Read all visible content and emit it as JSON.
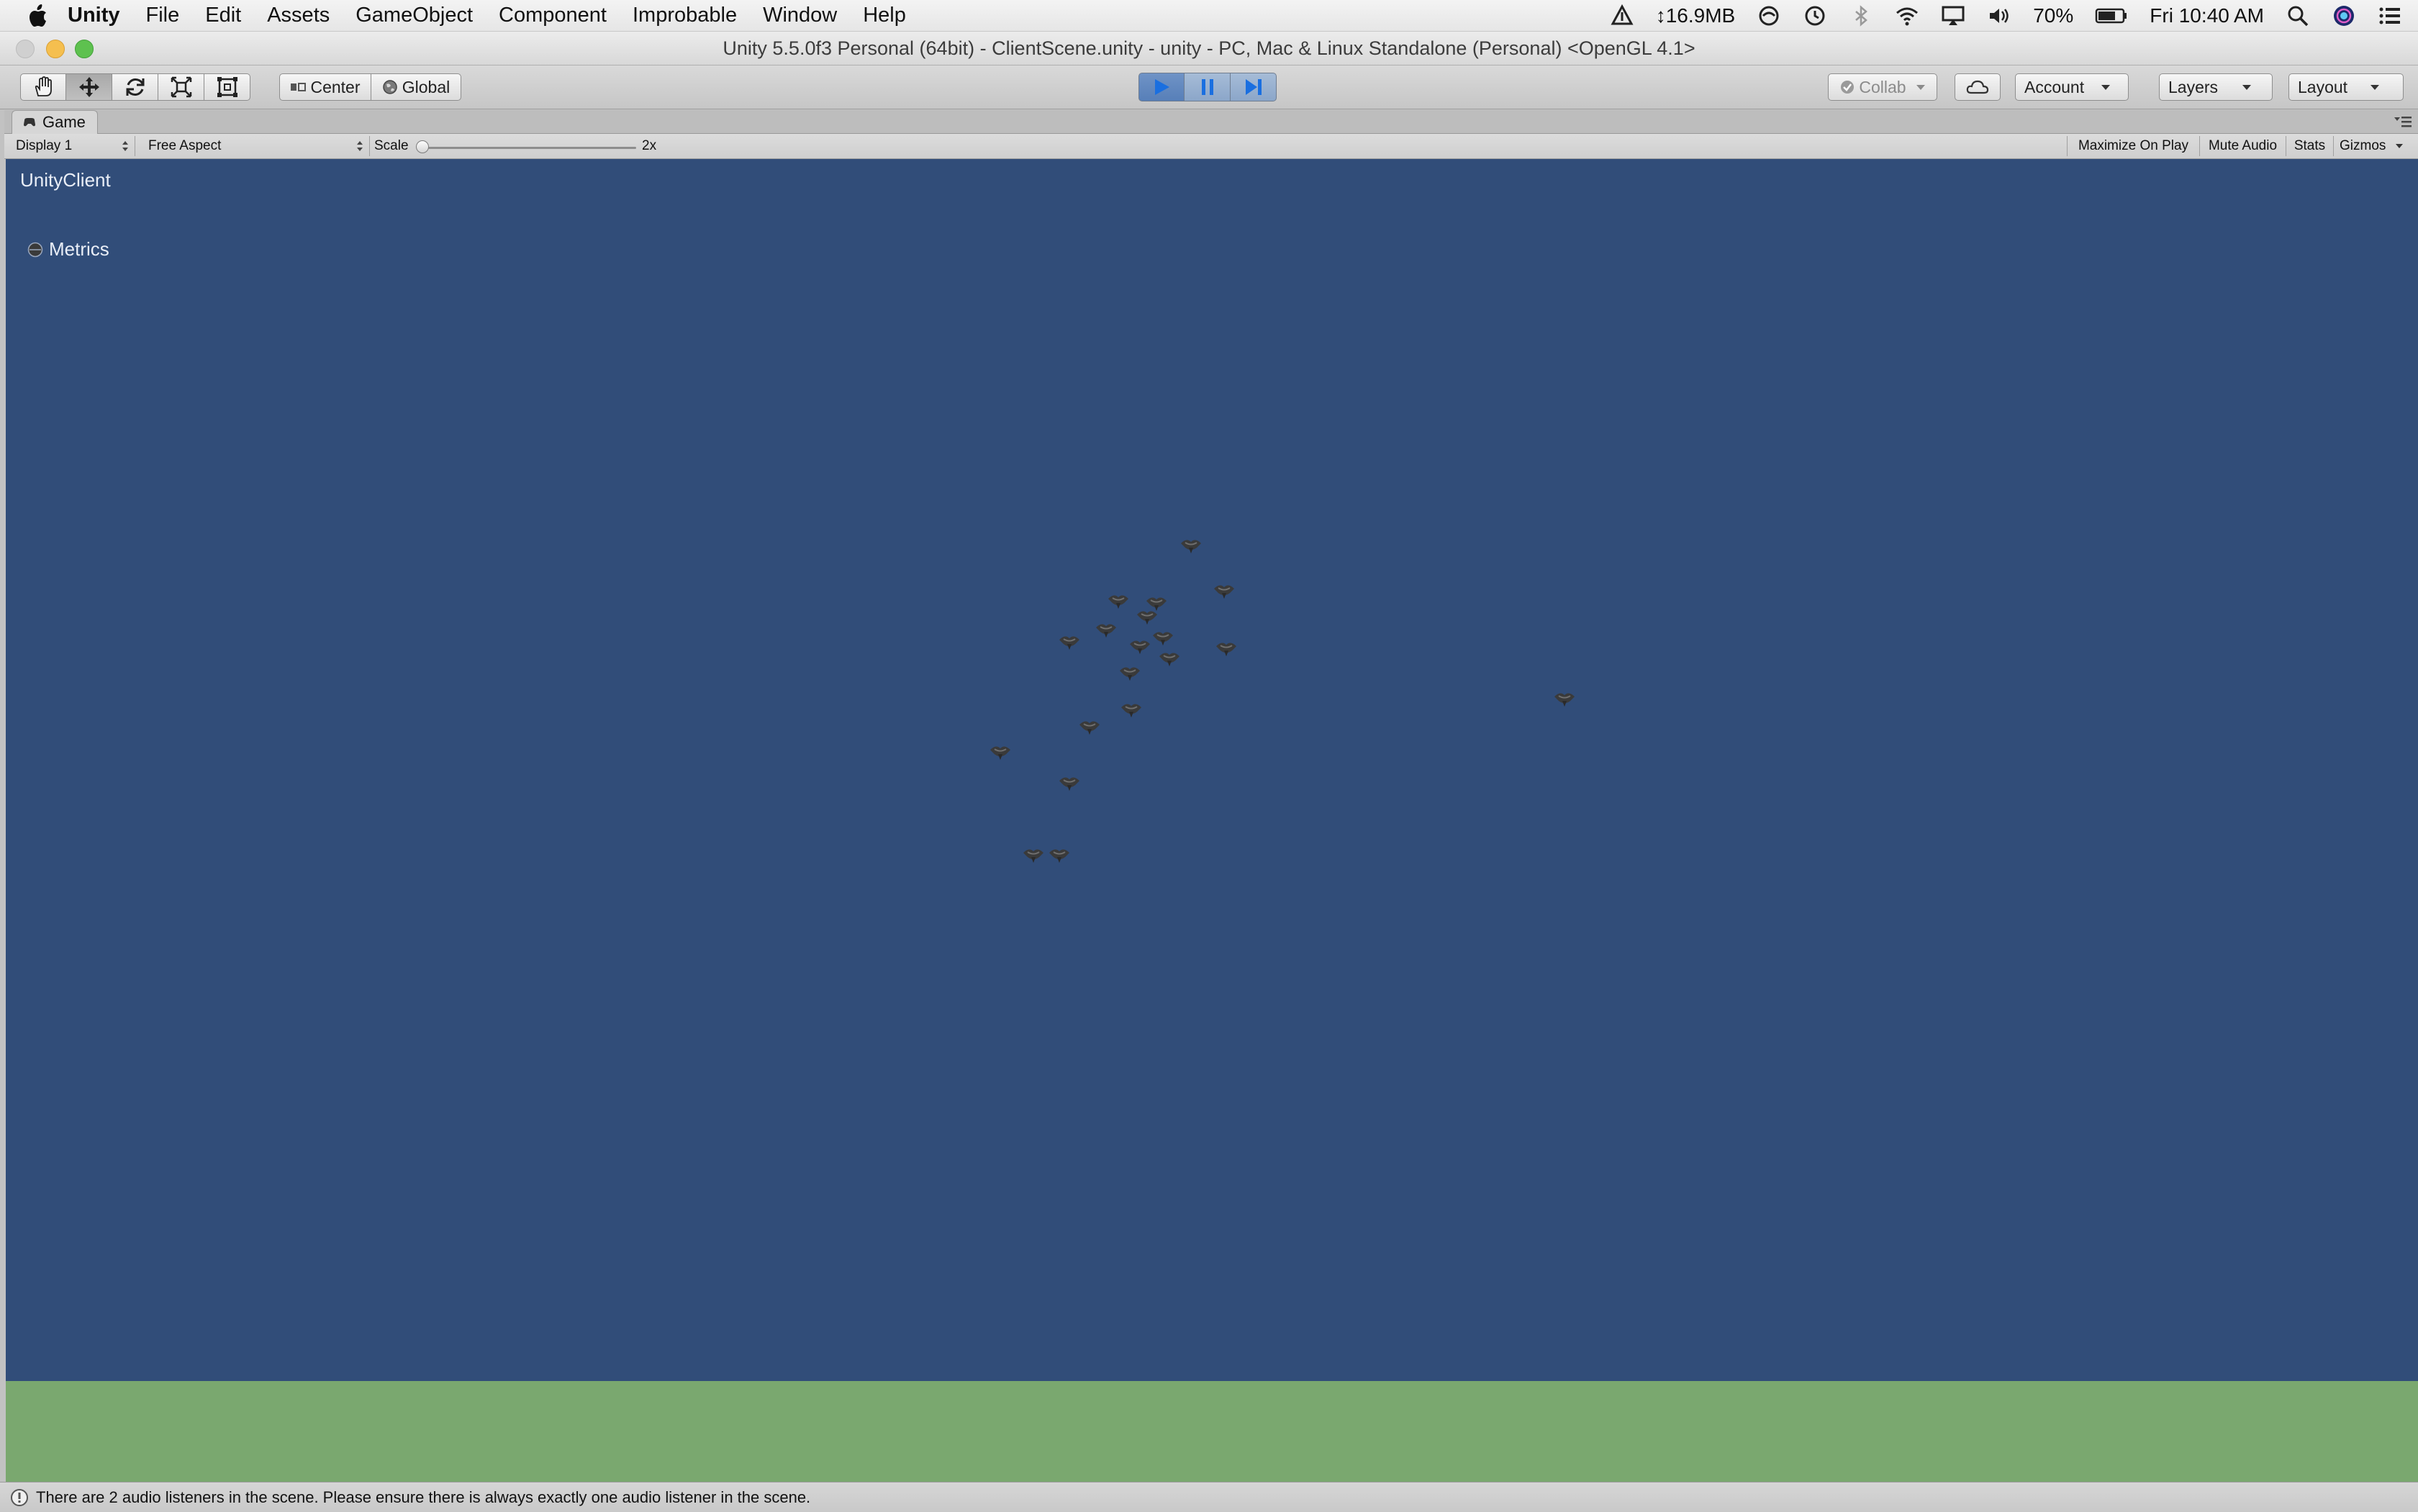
{
  "menubar": {
    "app": "Unity",
    "items": [
      "File",
      "Edit",
      "Assets",
      "GameObject",
      "Component",
      "Improbable",
      "Window",
      "Help"
    ],
    "network_speed": "↕16.9MB",
    "battery": "70%",
    "clock": "Fri 10:40 AM"
  },
  "window": {
    "title": "Unity 5.5.0f3 Personal (64bit) - ClientScene.unity - unity - PC, Mac & Linux Standalone (Personal) <OpenGL 4.1>"
  },
  "toolbar": {
    "active_tool": "move",
    "pivot_label": "Center",
    "space_label": "Global",
    "is_playing": true,
    "collab_label": "Collab",
    "account_label": "Account",
    "layers_label": "Layers",
    "layout_label": "Layout"
  },
  "game_view": {
    "tab_label": "Game",
    "display": "Display 1",
    "aspect": "Free Aspect",
    "scale_label": "Scale",
    "scale_value": "2x",
    "maximize_label": "Maximize On Play",
    "mute_label": "Mute Audio",
    "stats_label": "Stats",
    "gizmos_label": "Gizmos",
    "client_label": "UnityClient",
    "metrics_label": "Metrics",
    "sky_color": "#314d79",
    "ground_color": "#7aa86f"
  },
  "status": {
    "message": "There are 2 audio listeners in the scene. Please ensure there is always exactly one audio listener in the scene."
  }
}
